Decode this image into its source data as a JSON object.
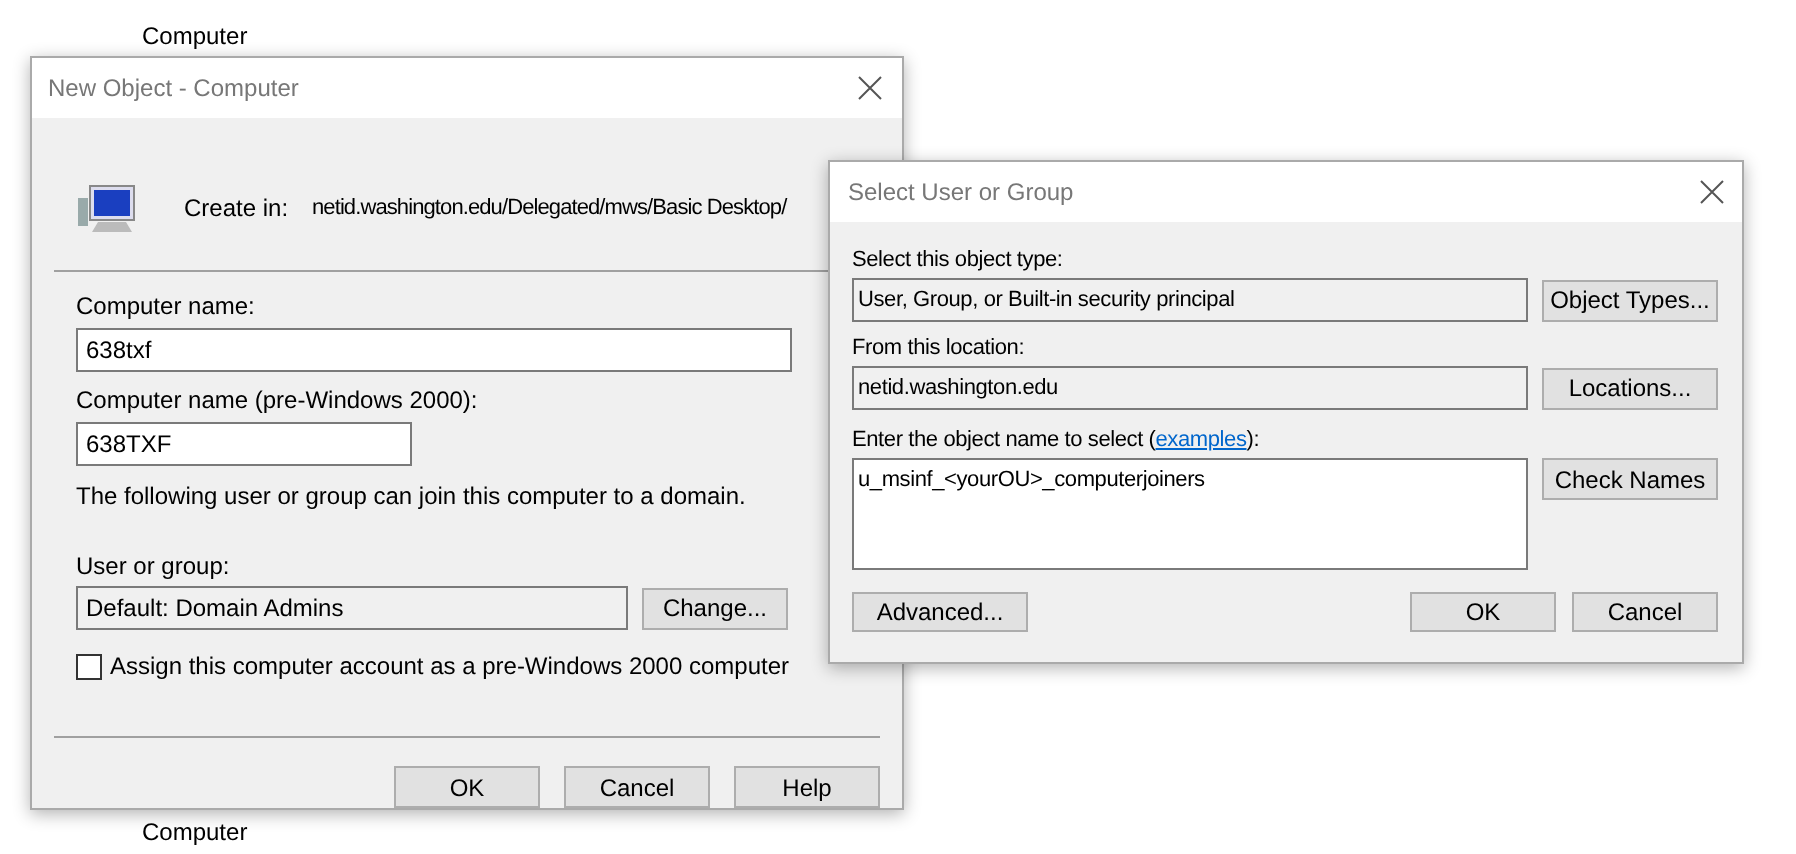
{
  "top_items": [
    "Computer"
  ],
  "bottom_items": [
    "Computer"
  ],
  "new_object_dialog": {
    "title": "New Object - Computer",
    "create_in_label": "Create in:",
    "create_in_path": "netid.washington.edu/Delegated/mws/Basic Desktop/",
    "fields": [
      {
        "label": "Computer name:",
        "value": "638txf",
        "kind": "wide"
      },
      {
        "label": "Computer name (pre-Windows 2000):",
        "value": "638TXF",
        "kind": "narrow"
      }
    ],
    "note": "The following user or group can join this computer to a domain.",
    "user_or_group": {
      "label": "User or group:",
      "value": "Default: Domain Admins",
      "button": "Change..."
    },
    "checkbox": {
      "label": "Assign this computer account as a pre-Windows 2000 computer",
      "checked": false
    },
    "buttons": [
      "OK",
      "Cancel",
      "Help"
    ]
  },
  "select_dialog": {
    "title": "Select User or Group",
    "rows": [
      {
        "label": "Select this object type:",
        "value": "User, Group, or Built-in security principal",
        "button": "Object Types..."
      },
      {
        "label": "From this location:",
        "value": "netid.washington.edu",
        "button": "Locations..."
      }
    ],
    "object_name": {
      "label_before": "Enter the object name to select (",
      "link": "examples",
      "label_after": "):",
      "value": "u_msinf_<yourOU>_computerjoiners",
      "button": "Check Names"
    },
    "advanced_button": "Advanced...",
    "buttons": [
      "OK",
      "Cancel"
    ]
  }
}
